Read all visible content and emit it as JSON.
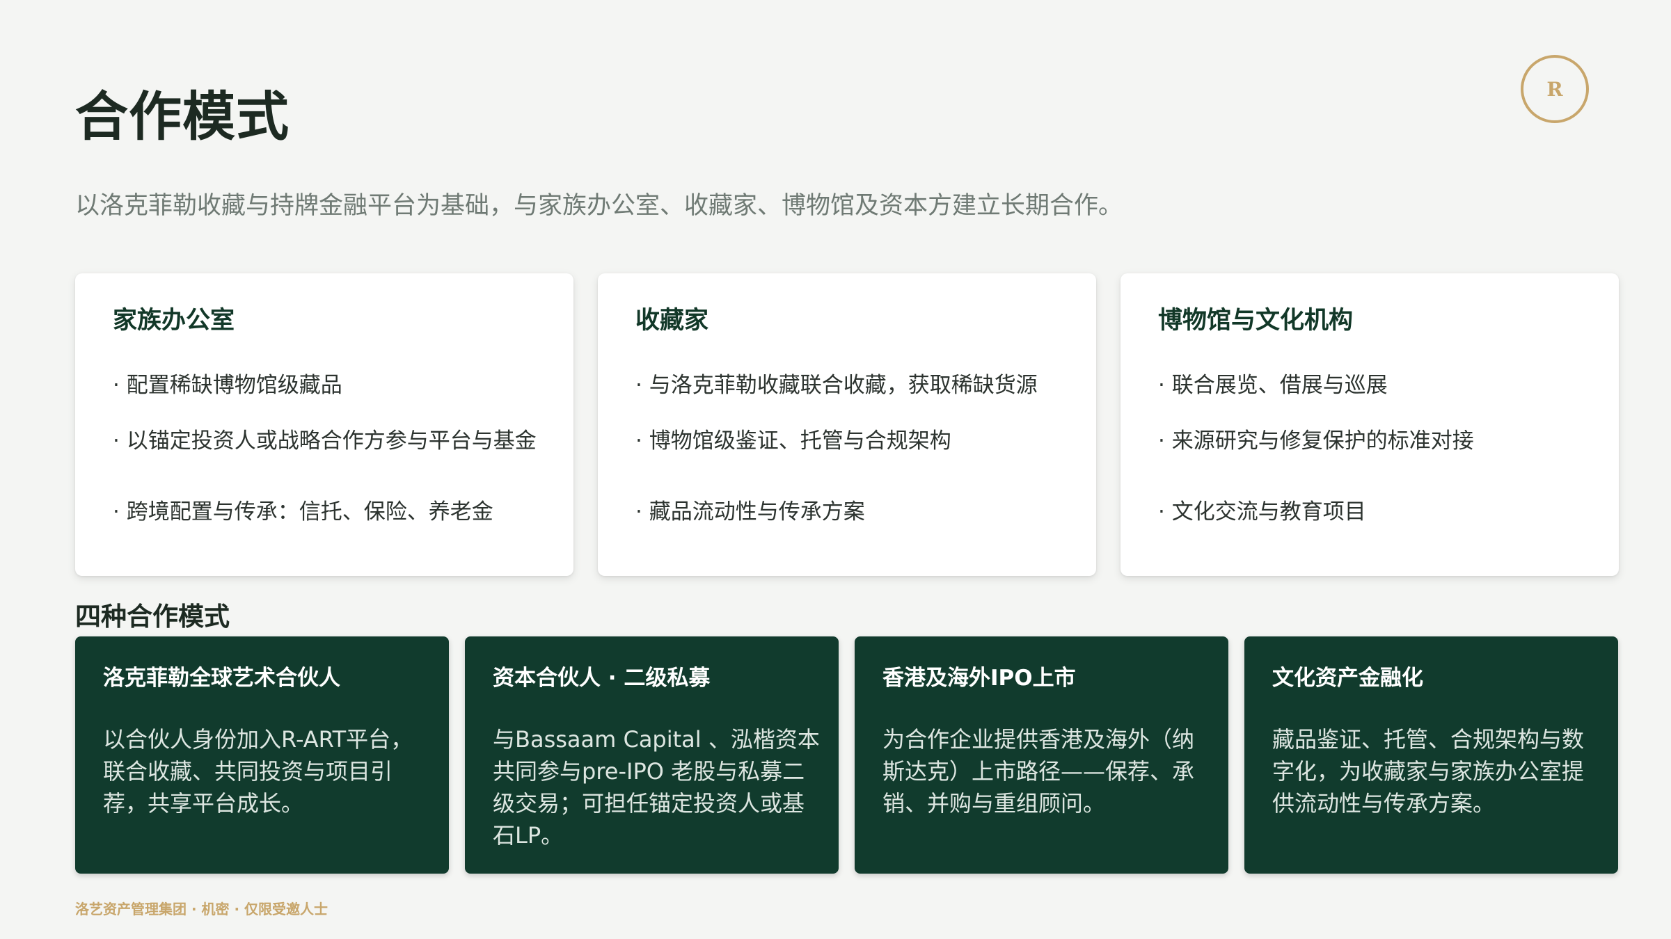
{
  "header": {
    "title": "合作模式",
    "subtitle": "以洛克菲勒收藏与持牌金融平台为基础，与家族办公室、收藏家、博物馆及资本方建立长期合作。",
    "logo_letter": "R"
  },
  "audiences": [
    {
      "title": "家族办公室",
      "bullets": [
        "· 配置稀缺博物馆级藏品",
        "· 以锚定投资人或战略合作方参与平台与基金",
        "· 跨境配置与传承：信托、保险、养老金"
      ]
    },
    {
      "title": "收藏家",
      "bullets": [
        "· 与洛克菲勒收藏联合收藏，获取稀缺货源",
        "· 博物馆级鉴证、托管与合规架构",
        "· 藏品流动性与传承方案"
      ]
    },
    {
      "title": "博物馆与文化机构",
      "bullets": [
        "· 联合展览、借展与巡展",
        "· 来源研究与修复保护的标准对接",
        "· 文化交流与教育项目"
      ]
    }
  ],
  "modes_heading": "四种合作模式",
  "modes": [
    {
      "title": "洛克菲勒全球艺术合伙人",
      "desc": "以合伙人身份加入R-ART平台，联合收藏、共同投资与项目引荐，共享平台成长。"
    },
    {
      "title": "资本合伙人 · 二级私募",
      "desc": "与Bassaam Capital 、泓楷资本共同参与pre-IPO 老股与私募二级交易；可担任锚定投资人或基石LP。"
    },
    {
      "title": "香港及海外IPO上市",
      "desc": "为合作企业提供香港及海外（纳斯达克）上市路径——保荐、承销、并购与重组顾问。"
    },
    {
      "title": "文化资产金融化",
      "desc": "藏品鉴证、托管、合规架构与数字化，为收藏家与家族办公室提供流动性与传承方案。"
    }
  ],
  "footer": {
    "note": "洛艺资产管理集团 · 机密 · 仅限受邀人士"
  },
  "colors": {
    "background": "#f4f5f3",
    "dark_green": "#113b2d",
    "gold": "#c8a66b",
    "title": "#1d2a22"
  }
}
